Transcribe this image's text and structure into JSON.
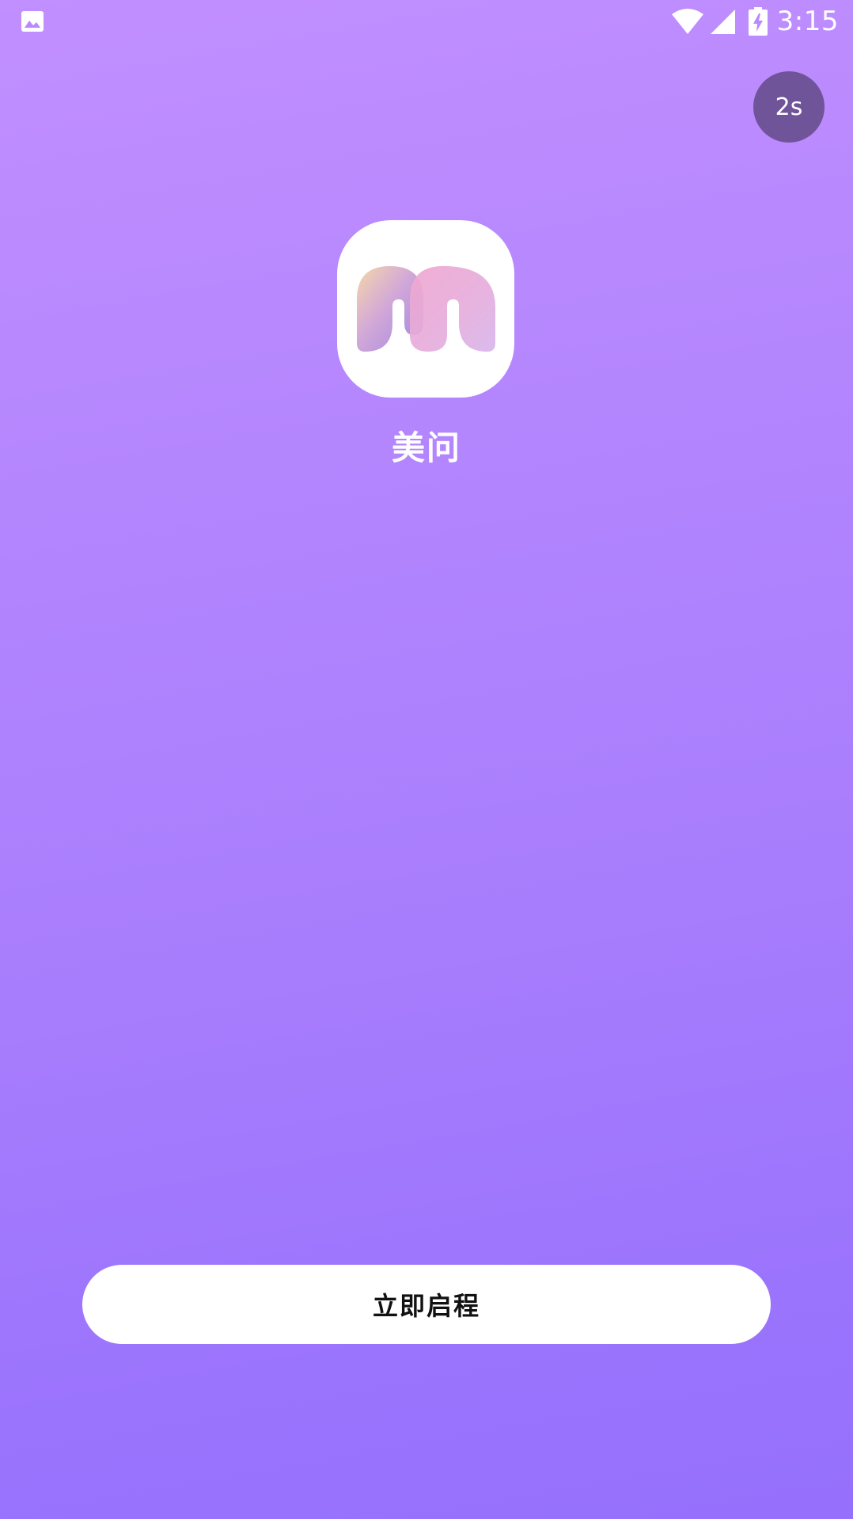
{
  "status_bar": {
    "time": "3:15",
    "icons": [
      "gallery-icon",
      "wifi-icon",
      "signal-icon",
      "battery-charging-icon"
    ]
  },
  "countdown": {
    "label": "2s"
  },
  "app": {
    "name": "美问",
    "logo_icon": "m-logo-icon"
  },
  "start_button": {
    "label": "立即启程"
  },
  "colors": {
    "background_top": "#c18fff",
    "background_bottom": "#9570fc",
    "countdown_bg": "#705499",
    "button_bg": "#ffffff",
    "button_text": "#111111"
  }
}
